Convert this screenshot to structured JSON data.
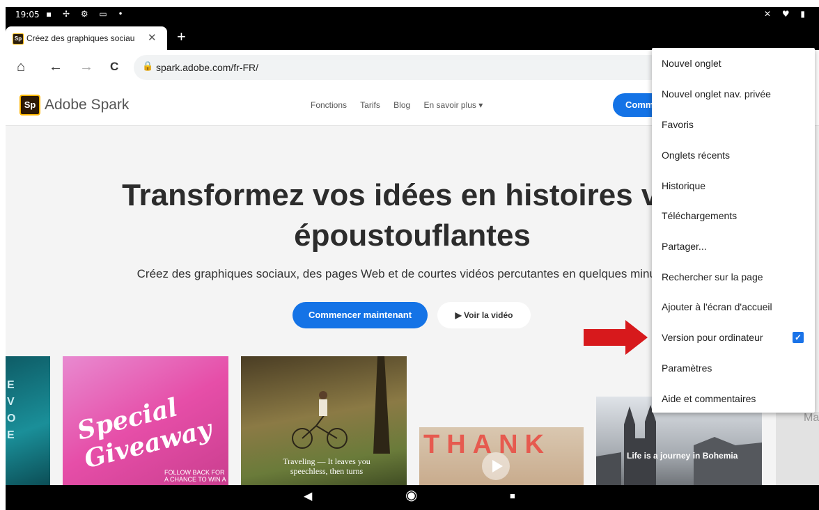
{
  "status_bar": {
    "time": "19:05",
    "left_icons": "▪ ✢ ⚙ ▭ •",
    "right_icons": "✕ ♥ ▮"
  },
  "browser": {
    "tab": {
      "favicon": "Sp",
      "title": "Créez des graphiques sociau",
      "close": "✕"
    },
    "new_tab": "+",
    "toolbar": {
      "home": "⌂",
      "back": "←",
      "forward": "→",
      "reload": "C",
      "lock": "🔒",
      "url": "spark.adobe.com/fr-FR/"
    }
  },
  "site": {
    "logo_mark": "Sp",
    "brand": "Adobe Spark",
    "nav": [
      "Fonctions",
      "Tarifs",
      "Blog",
      "En savoir plus ▾"
    ],
    "top_cta": "Comm",
    "hero_title_line1": "Transformez vos idées en histoires visu",
    "hero_title_line2": "époustouflantes",
    "hero_subtitle": "Créez des graphiques sociaux, des pages Web et de courtes vidéos percutantes en quelques minutes av",
    "cta_primary": "Commencer maintenant",
    "cta_secondary": "▶ Voir la vidéo",
    "cards": {
      "c1_letters": "E\nV\nO\nE",
      "c2_title": "Special\nGiveaway",
      "c2_fine": "FOLLOW BACK FOR\nA CHANCE TO WIN A",
      "c3_quote": "Traveling — It leaves you speechless, then turns",
      "c4_text": "THANK",
      "c5_caption": "Life is a journey in Bohemia",
      "c6_text": "Ma"
    }
  },
  "menu": {
    "items": [
      "Nouvel onglet",
      "Nouvel onglet nav. privée",
      "Favoris",
      "Onglets récents",
      "Historique",
      "Téléchargements",
      "Partager...",
      "Rechercher sur la page",
      "Ajouter à l'écran d'accueil",
      "Version pour ordinateur",
      "Paramètres",
      "Aide et commentaires"
    ],
    "desktop_version_checked": true,
    "check_glyph": "✓"
  },
  "nav_bar": {
    "back": "◀",
    "home": "◉",
    "recents": "■"
  },
  "colors": {
    "accent": "#1473e6",
    "arrow": "#d7191c",
    "checkbox": "#1a73e8"
  }
}
